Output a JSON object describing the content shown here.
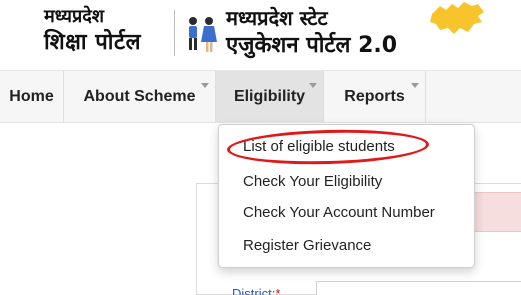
{
  "header": {
    "left_brand_line1": "मध्यप्रदेश",
    "left_brand_line2": "शिक्षा पोर्टल",
    "right_brand_line1": "मध्यप्रदेश स्टेट",
    "right_brand_line2": "एजुकेशन पोर्टल 2.0",
    "map_color": "#f7c52b"
  },
  "nav": {
    "items": [
      {
        "label": "Home"
      },
      {
        "label": "About Scheme"
      },
      {
        "label": "Eligibility"
      },
      {
        "label": "Reports"
      }
    ]
  },
  "dropdown": {
    "items": [
      {
        "label": "List of eligible students"
      },
      {
        "label": "Check Your Eligibility"
      },
      {
        "label": "Check Your Account Number"
      },
      {
        "label": "Register Grievance"
      }
    ]
  },
  "form": {
    "district_label": "District:",
    "required_mark": "*"
  },
  "colors": {
    "highlight": "#e01818",
    "nav_bg": "#f6f6f6",
    "nav_active_bg": "#e3e3e3",
    "label_blue": "#2a5bb0"
  }
}
